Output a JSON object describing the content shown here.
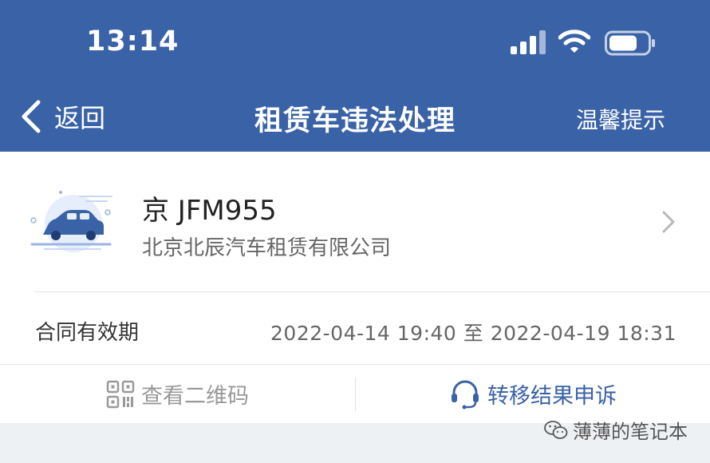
{
  "status_bar": {
    "time": "13:14",
    "signal_icon": "signal-bars-icon",
    "wifi_icon": "wifi-icon",
    "battery_icon": "battery-icon"
  },
  "nav": {
    "back_label": "返回",
    "title": "租赁车违法处理",
    "tip_label": "温馨提示"
  },
  "vehicle": {
    "plate": "京 JFM955",
    "company": "北京北辰汽车租赁有限公司"
  },
  "contract": {
    "label": "合同有效期",
    "value": "2022-04-14 19:40 至 2022-04-19 18:31"
  },
  "actions": {
    "qr_label": "查看二维码",
    "appeal_label": "转移结果申诉"
  },
  "colors": {
    "header_bg": "#3a62a7",
    "accent": "#3a62a7",
    "page_bg": "#eef1f4"
  },
  "watermark": {
    "text": "薄薄的笔记本"
  }
}
